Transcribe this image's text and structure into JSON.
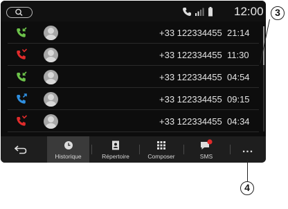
{
  "status_bar": {
    "clock": "12:00",
    "icons": [
      "search-icon",
      "phone-icon",
      "signal-icon",
      "battery-icon"
    ]
  },
  "call_log": [
    {
      "type": "incoming",
      "color": "#6cc24a",
      "number": "+33 122334455",
      "time": "21:14"
    },
    {
      "type": "missed",
      "color": "#e02b2b",
      "number": "+33 122334455",
      "time": "11:30"
    },
    {
      "type": "incoming",
      "color": "#6cc24a",
      "number": "+33 122334455",
      "time": "04:54"
    },
    {
      "type": "outgoing",
      "color": "#2f8fe0",
      "number": "+33 122334455",
      "time": "09:15"
    },
    {
      "type": "missed",
      "color": "#e02b2b",
      "number": "+33 122334455",
      "time": "04:34"
    }
  ],
  "tabs": [
    {
      "id": "back",
      "label": "",
      "icon": "back-arrow-icon"
    },
    {
      "id": "historique",
      "label": "Historique",
      "icon": "clock-icon",
      "active": true
    },
    {
      "id": "repertoire",
      "label": "Répertoire",
      "icon": "contacts-book-icon"
    },
    {
      "id": "composer",
      "label": "Composer",
      "icon": "keypad-icon"
    },
    {
      "id": "sms",
      "label": "SMS",
      "icon": "chat-bubble-icon",
      "badge_color": "#e02b2b"
    },
    {
      "id": "more",
      "label": "...",
      "icon": "more-icon"
    }
  ],
  "callouts": {
    "scrollbar": "3",
    "more_button": "4"
  }
}
